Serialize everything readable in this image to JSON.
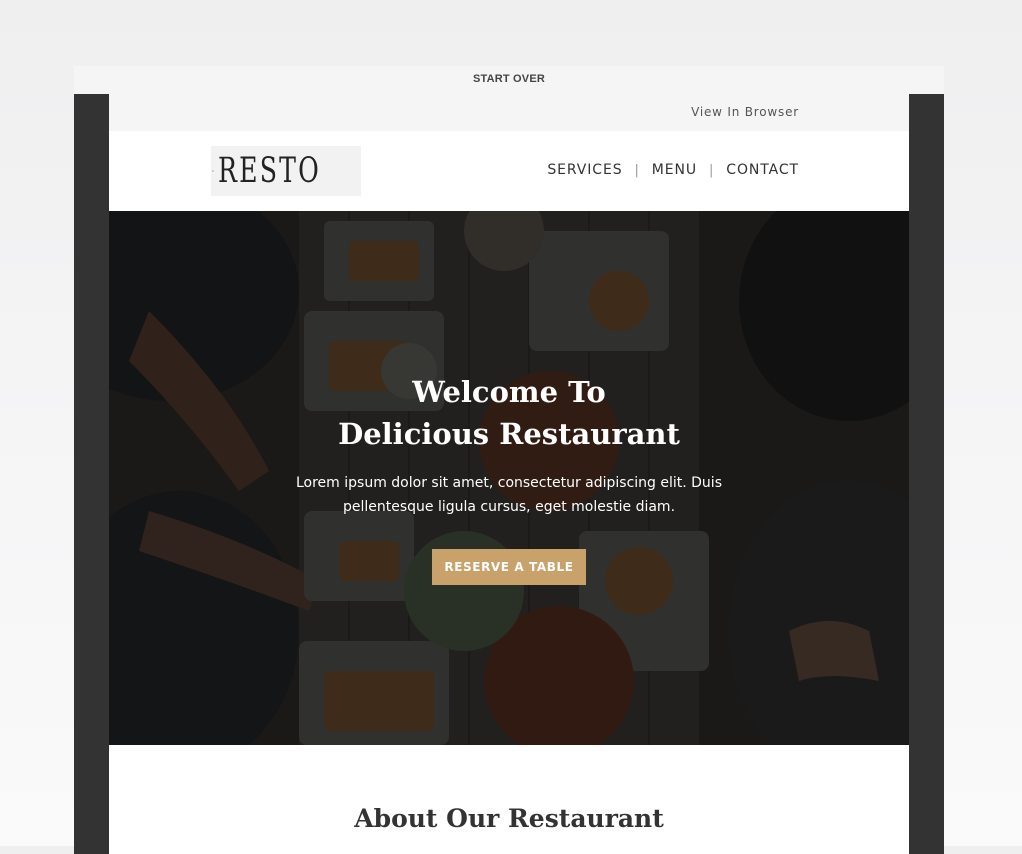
{
  "topbar": {
    "start_over": "START OVER"
  },
  "preheader": {
    "view_in_browser": "View In Browser"
  },
  "header": {
    "logo_text": "RESTO",
    "nav": [
      {
        "label": "SERVICES"
      },
      {
        "label": "MENU"
      },
      {
        "label": "CONTACT"
      }
    ]
  },
  "hero": {
    "title_line1": "Welcome To",
    "title_line2": "Delicious Restaurant",
    "text": "Lorem ipsum dolor sit amet, consectetur adipiscing elit. Duis pellentesque ligula cursus, eget molestie diam.",
    "button": "RESERVE A TABLE"
  },
  "about": {
    "title": "About Our Restaurant"
  },
  "colors": {
    "accent": "#c9a26b",
    "frame": "#333333",
    "preheader_bg": "#f5f5f5"
  },
  "icons": {
    "logo": "plate-fork-knife-icon"
  }
}
